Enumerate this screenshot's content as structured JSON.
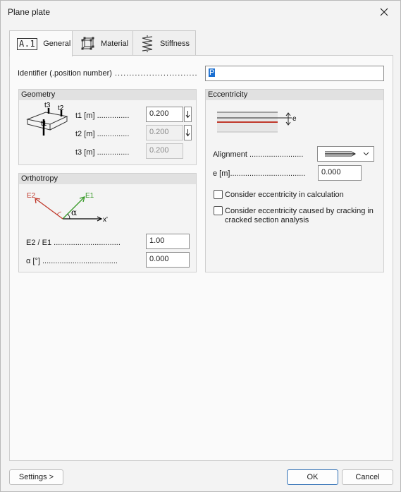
{
  "window": {
    "title": "Plane plate"
  },
  "tabs": [
    {
      "label": "General",
      "icon": "a1-icon",
      "icon_text": "A.1"
    },
    {
      "label": "Material",
      "icon": "cube-node-icon"
    },
    {
      "label": "Stiffness",
      "icon": "spring-icon"
    }
  ],
  "identifier": {
    "label": "Identifier (.position number)",
    "value": "P"
  },
  "geometry": {
    "header": "Geometry",
    "diagram_labels": {
      "t1": "t1",
      "t2": "t2",
      "t3": "t3"
    },
    "t1": {
      "label": "t1 [m]",
      "value": "0.200"
    },
    "t2": {
      "label": "t2 [m]",
      "value": "0.200"
    },
    "t3": {
      "label": "t3 [m]",
      "value": "0.200"
    }
  },
  "orthotropy": {
    "header": "Orthotropy",
    "diagram_labels": {
      "e1": "E1",
      "e2": "E2",
      "x": "x'",
      "alpha": "α"
    },
    "ratio": {
      "label": "E2 / E1",
      "value": "1.00"
    },
    "alpha": {
      "label": "α [°]",
      "value": "0.000"
    },
    "colors": {
      "e1": "#3a9a2a",
      "e2": "#c0392b"
    }
  },
  "eccentricity": {
    "header": "Eccentricity",
    "diagram_label": "e",
    "alignment": {
      "label": "Alignment"
    },
    "e": {
      "label": "e [m]",
      "value": "0.000"
    },
    "check1": {
      "label": "Consider eccentricity in calculation",
      "checked": false
    },
    "check2": {
      "label": "Consider eccentricity caused by cracking in cracked section analysis",
      "checked": false
    },
    "line_color": "#c0392b"
  },
  "footer": {
    "settings": "Settings >",
    "ok": "OK",
    "cancel": "Cancel"
  },
  "colors": {
    "accent": "#2f6fb5",
    "selection": "#1a6fd1"
  }
}
